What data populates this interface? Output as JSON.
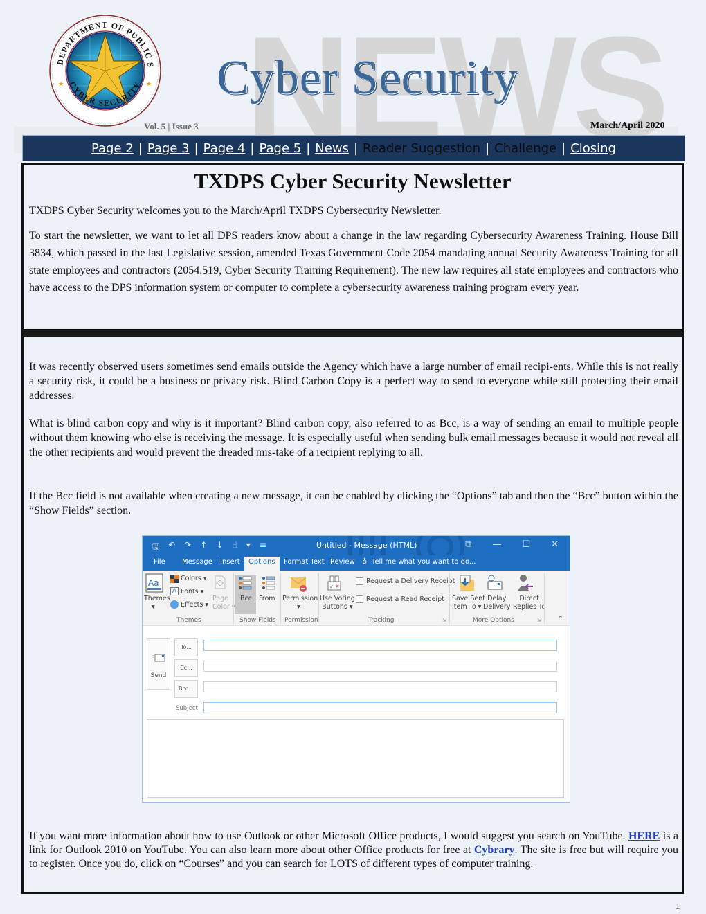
{
  "masthead": {
    "watermark": "NEWS",
    "title": "Cyber Security",
    "volume_issue": "Vol. 5 | Issue 3",
    "date": "March/April 2020",
    "seal": {
      "top_text": "Texas Department of Public Safety",
      "bottom_text": "Cyber Security"
    }
  },
  "nav": {
    "items": [
      {
        "label": "Page 2",
        "linked": true
      },
      {
        "label": "Page 3",
        "linked": true
      },
      {
        "label": "Page 4",
        "linked": true
      },
      {
        "label": "Page 5",
        "linked": true
      },
      {
        "label": "News",
        "linked": true
      },
      {
        "label": "Reader Suggestion",
        "linked": false
      },
      {
        "label": "Challenge",
        "linked": false
      },
      {
        "label": "Closing",
        "linked": true
      }
    ],
    "separator": "|"
  },
  "article": {
    "title": "TXDPS Cyber Security Newsletter",
    "welcome": "TXDPS Cyber Security welcomes you to the March/April TXDPS Cybersecurity Newsletter.",
    "law_start": "To start the newsletter",
    "law_comma": ",",
    "law_rest": " we want to let all DPS readers know about a change in the law regarding Cybersecurity Awareness Training.  House Bill 3834, which passed in the last Legislative session, amended Texas Government Code 2054 mandating annual Security Awareness Training for all state employees and contractors (2054.519, Cyber Security Training Requirement). The new law requires all state employees and contractors who have access to the DPS information system or computer to complete a cybersecurity awareness training program every year.",
    "bcc_paragraph_1": "It was recently observed users sometimes send emails outside the Agency which have a large number of email recipi-ents.  While this is not really a security risk, it could be a business or privacy risk.  Blind Carbon Copy is a perfect way to send to everyone while still protecting their email addresses.",
    "bcc_paragraph_2": "What is blind carbon copy and why is it important?  Blind carbon copy, also referred to as Bcc, is a way of sending an email to multiple people without them knowing who else is receiving the message.  It is especially useful when sending bulk email messages because it would not reveal all the other recipients and would prevent the dreaded mis-take of a recipient replying to all.",
    "bcc_paragraph_3": "If the Bcc field is not available when creating a new message, it can be enabled by clicking the “Options” tab and then the “Bcc” button within the “Show Fields” section.",
    "final_part1": "If you want more information about how to use Outlook or other Microsoft Office products, I would suggest you search on YouTube.  ",
    "final_link_here": "HERE",
    "final_part2": " is a link for Outlook 2010 on YouTube.  You can also learn more about other Office products for free at ",
    "final_link_cybrary": "Cybrary",
    "final_part3": ".  The site is free but will require you to register.  Once you do, click on “Courses” and you can search for LOTS of different types of computer training."
  },
  "outlook": {
    "window_title": "Untitled - Message (HTML)",
    "tabs": [
      "File",
      "Message",
      "Insert",
      "Options",
      "Format Text",
      "Review"
    ],
    "active_tab": "Options",
    "tell_me": "Tell me what you want to do...",
    "ribbon": {
      "themes": "Themes",
      "colors": "Colors",
      "fonts": "Fonts",
      "effects": "Effects",
      "page_color_1": "Page",
      "page_color_2": "Color",
      "bcc": "Bcc",
      "from": "From",
      "permission": "Permission",
      "use_voting_1": "Use Voting",
      "use_voting_2": "Buttons",
      "delivery_receipt": "Request a Delivery Receipt",
      "read_receipt": "Request a Read Receipt",
      "save_sent_1": "Save Sent",
      "save_sent_2": "Item To",
      "delay_1": "Delay",
      "delay_2": "Delivery",
      "direct_1": "Direct",
      "direct_2": "Replies To",
      "groups": [
        "Themes",
        "Show Fields",
        "Permission",
        "Tracking",
        "More Options"
      ]
    },
    "compose": {
      "send": "Send",
      "to": "To...",
      "cc": "Cc...",
      "bcc": "Bcc...",
      "subject": "Subject"
    }
  },
  "colors": {
    "nav_bg": "#1b365c",
    "title_blue": "#3c6799",
    "outlook_blue": "#1e6fc2",
    "link_blue": "#1f3fbf"
  },
  "page_number": "1"
}
